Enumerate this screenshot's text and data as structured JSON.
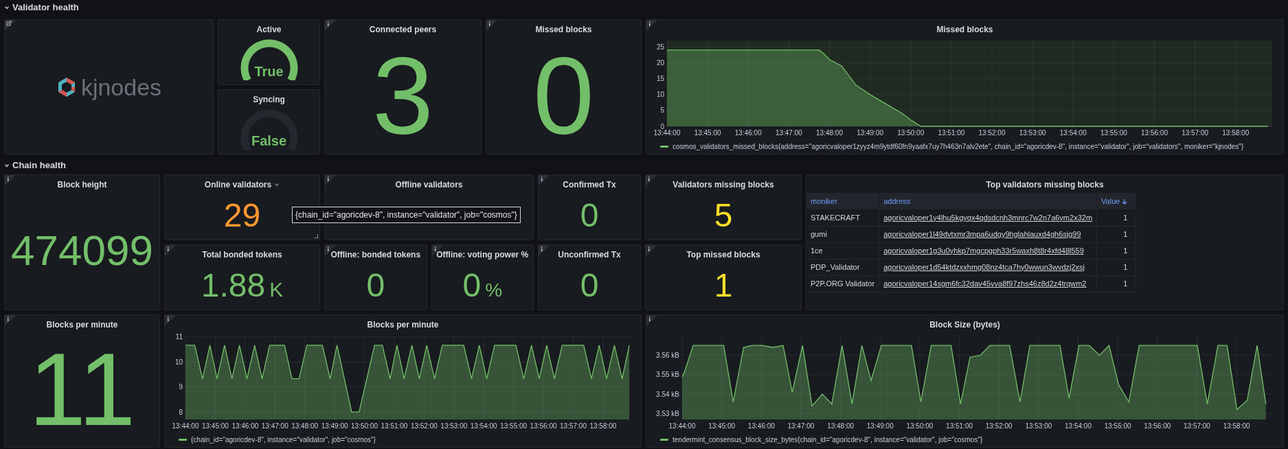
{
  "validator_health": {
    "title": "Validator health",
    "expanded": true,
    "logo": {
      "text": "kjnodes",
      "link": true
    },
    "gauges": [
      {
        "title": "Active",
        "value": "True",
        "on": true
      },
      {
        "title": "Syncing",
        "value": "False",
        "on": false
      }
    ],
    "stats": [
      {
        "title": "Connected peers",
        "value": "3",
        "color": "#73bf69",
        "info": true
      },
      {
        "title": "Missed blocks",
        "value": "0",
        "color": "#73bf69",
        "info": true
      }
    ],
    "chart": {
      "title": "Missed blocks",
      "info": true,
      "chart_data": {
        "type": "area",
        "grid": true,
        "xlim": [
          824,
          838.9
        ],
        "ylim": [
          0,
          27
        ],
        "xticks": [
          {
            "value": 824,
            "label": "13:44:00"
          },
          {
            "value": 825,
            "label": "13:45:00"
          },
          {
            "value": 826,
            "label": "13:46:00"
          },
          {
            "value": 827,
            "label": "13:47:00"
          },
          {
            "value": 828,
            "label": "13:48:00"
          },
          {
            "value": 829,
            "label": "13:49:00"
          },
          {
            "value": 830,
            "label": "13:50:00"
          },
          {
            "value": 831,
            "label": "13:51:00"
          },
          {
            "value": 832,
            "label": "13:52:00"
          },
          {
            "value": 833,
            "label": "13:53:00"
          },
          {
            "value": 834,
            "label": "13:54:00"
          },
          {
            "value": 835,
            "label": "13:55:00"
          },
          {
            "value": 836,
            "label": "13:56:00"
          },
          {
            "value": 837,
            "label": "13:57:00"
          },
          {
            "value": 838,
            "label": "13:58:00"
          }
        ],
        "yticks": [
          0,
          5,
          10,
          15,
          20,
          25
        ],
        "x": [
          824,
          827.75,
          827.85,
          828,
          828.3,
          828.65,
          829,
          829.4,
          829.8,
          830,
          830.25,
          838.8
        ],
        "series": [
          {
            "name": "cosmos_validators_missed_blocks{address=\"agoricvaloper1zyyz4m9ytdf60fn9yaafx7uy7h463n7alv2ete\", chain_id=\"agoricdev-8\", instance=\"validator\", job=\"validators\", moniker=\"kjnodes\"}",
            "color": "#73bf69",
            "values": [
              24,
              24,
              23,
              21,
              19,
              13,
              10,
              7,
              4,
              2,
              0,
              0
            ]
          }
        ]
      }
    }
  },
  "chain_health": {
    "title": "Chain health",
    "expanded": true,
    "stats": [
      {
        "title": "Block height",
        "value": "474099",
        "color": "#73bf69",
        "info": true
      },
      {
        "title": "Online validators",
        "value": "29",
        "color": "#ff9830",
        "hovered": true
      },
      {
        "title": "Offline validators",
        "info": true
      },
      {
        "title": "Confirmed Tx",
        "value": "0",
        "color": "#73bf69",
        "info": true
      },
      {
        "title": "Validators missing blocks",
        "value": "5",
        "color": "#fade2a",
        "info": true
      },
      {
        "title": "Total bonded tokens",
        "value": "1.88",
        "unit": "K",
        "color": "#73bf69",
        "info": true
      },
      {
        "title": "Offline: bonded tokens",
        "value": "0",
        "color": "#73bf69",
        "info": true
      },
      {
        "title": "Offline: voting power %",
        "value": "0",
        "unit": "%",
        "color": "#73bf69",
        "info": true
      },
      {
        "title": "Unconfirmed Tx",
        "value": "0",
        "color": "#73bf69",
        "info": true
      },
      {
        "title": "Top missed blocks",
        "value": "1",
        "color": "#fade2a",
        "info": true
      }
    ],
    "tooltip": {
      "text": "{chain_id=\"agoricdev-8\", instance=\"validator\", job=\"cosmos\"}"
    },
    "table": {
      "title": "Top validators missing blocks",
      "columns": [
        {
          "label": "moniker"
        },
        {
          "label": "address"
        },
        {
          "label": "Value",
          "sort_descending": true
        }
      ],
      "rows": [
        [
          "STAKECRAFT",
          "agoricvaloper1y4lhu5kgyqx4qdsdcnh3mnrc7w2n7a6ym2x32m",
          "1"
        ],
        [
          "gumi",
          "agoricvaloper1l49dvtxmr3mpa6udgy9hglahlauxd4gh6sjg99",
          "1"
        ],
        [
          "1ce",
          "agoricvaloper1g3u0yhkp7mgcpgph33r5waxh8t8r4xfd48l559",
          "1"
        ],
        [
          "PDP_Validator",
          "agoricvaloper1d54ktdzxxhmg08nz4tca7hy0wwun3wvdzj2xsj",
          "1"
        ],
        [
          "P2P.ORG Validator",
          "agoricvaloper14sgm6fc32dav45vva8f97zhs46z8d2z4trqwm2",
          "1"
        ]
      ]
    },
    "blocks_stat": {
      "title": "Blocks per minute",
      "value": "11",
      "color": "#73bf69",
      "info": true
    },
    "charts": [
      {
        "title": "Blocks per minute",
        "info": true,
        "chart_data": {
          "type": "area",
          "grid": true,
          "xlim": [
            824,
            838.9
          ],
          "ylim": [
            7.7,
            11.05
          ],
          "xticks": [
            {
              "value": 824,
              "label": "13:44:00"
            },
            {
              "value": 825,
              "label": "13:45:00"
            },
            {
              "value": 826,
              "label": "13:46:00"
            },
            {
              "value": 827,
              "label": "13:47:00"
            },
            {
              "value": 828,
              "label": "13:48:00"
            },
            {
              "value": 829,
              "label": "13:49:00"
            },
            {
              "value": 830,
              "label": "13:50:00"
            },
            {
              "value": 831,
              "label": "13:51:00"
            },
            {
              "value": 832,
              "label": "13:52:00"
            },
            {
              "value": 833,
              "label": "13:53:00"
            },
            {
              "value": 834,
              "label": "13:54:00"
            },
            {
              "value": 835,
              "label": "13:55:00"
            },
            {
              "value": 836,
              "label": "13:56:00"
            },
            {
              "value": 837,
              "label": "13:57:00"
            },
            {
              "value": 838,
              "label": "13:58:00"
            }
          ],
          "yticks": [
            8,
            9,
            10,
            11
          ],
          "x": [
            824,
            824.31,
            824.57,
            824.82,
            825.06,
            825.31,
            825.56,
            825.81,
            826.06,
            826.32,
            826.57,
            826.82,
            827.32,
            827.57,
            827.81,
            828.07,
            828.59,
            828.85,
            829.08,
            829.57,
            829.82,
            830.34,
            830.6,
            830.86,
            831.09,
            831.33,
            831.59,
            831.84,
            832.09,
            832.35,
            832.61,
            833.33,
            833.59,
            833.85,
            834.1,
            834.36,
            835.08,
            835.34,
            835.6,
            835.86,
            836.11,
            836.37,
            836.63,
            837.35,
            837.61,
            837.87,
            838.12,
            838.38,
            838.64,
            838.88
          ],
          "series": [
            {
              "name": "{chain_id=\"agoricdev-8\", instance=\"validator\", job=\"cosmos\"}",
              "color": "#73bf69",
              "values": [
                10.67,
                10.67,
                9.33,
                10.67,
                9.33,
                10.67,
                9.33,
                10.67,
                9.33,
                10.67,
                9.33,
                10.67,
                10.67,
                9.33,
                9.33,
                10.67,
                10.67,
                9.33,
                10.67,
                8,
                8,
                10.67,
                10.67,
                9.33,
                10.67,
                9.33,
                10.67,
                9.33,
                10.67,
                9.33,
                10.67,
                10.67,
                9.33,
                10.67,
                9.33,
                10.67,
                10.67,
                9.33,
                10.67,
                9.33,
                10.67,
                9.33,
                10.67,
                10.67,
                9.33,
                10.67,
                9.33,
                10.67,
                9.33,
                10.67
              ]
            }
          ]
        }
      },
      {
        "title": "Block Size (bytes)",
        "info": true,
        "chart_data": {
          "type": "area",
          "grid": true,
          "xlim": [
            824,
            838.9
          ],
          "ylim": [
            3.527,
            3.57
          ],
          "xticks": [
            {
              "value": 824,
              "label": "13:44:00"
            },
            {
              "value": 825,
              "label": "13:45:00"
            },
            {
              "value": 826,
              "label": "13:46:00"
            },
            {
              "value": 827,
              "label": "13:47:00"
            },
            {
              "value": 828,
              "label": "13:48:00"
            },
            {
              "value": 829,
              "label": "13:49:00"
            },
            {
              "value": 830,
              "label": "13:50:00"
            },
            {
              "value": 831,
              "label": "13:51:00"
            },
            {
              "value": 832,
              "label": "13:52:00"
            },
            {
              "value": 833,
              "label": "13:53:00"
            },
            {
              "value": 834,
              "label": "13:54:00"
            },
            {
              "value": 835,
              "label": "13:55:00"
            },
            {
              "value": 836,
              "label": "13:56:00"
            },
            {
              "value": 837,
              "label": "13:57:00"
            },
            {
              "value": 838,
              "label": "13:58:00"
            }
          ],
          "yticks": [
            {
              "value": 3.53,
              "label": "3.53 kB"
            },
            {
              "value": 3.54,
              "label": "3.54 kB"
            },
            {
              "value": 3.55,
              "label": "3.55 kB"
            },
            {
              "value": 3.56,
              "label": "3.56 kB"
            }
          ],
          "x": [
            824,
            824.05,
            824.28,
            825.05,
            825.29,
            825.55,
            825.77,
            826.03,
            826.29,
            826.55,
            826.78,
            827.04,
            827.28,
            827.54,
            827.78,
            828.04,
            828.29,
            828.54,
            828.77,
            829.03,
            829.79,
            830.03,
            830.29,
            830.79,
            831.03,
            831.27,
            831.53,
            831.77,
            832.27,
            832.53,
            832.78,
            833.54,
            833.77,
            834.02,
            834.28,
            834.54,
            834.78,
            835.02,
            835.28,
            835.54,
            837.01,
            837.26,
            837.53,
            837.76,
            838.01,
            838.27,
            838.52,
            838.74
          ],
          "series": [
            {
              "name": "tendermint_consensus_block_size_bytes{chain_id=\"agoricdev-8\", instance=\"validator\", job=\"cosmos\"}",
              "color": "#73bf69",
              "values": [
                3.549,
                3.551,
                3.565,
                3.565,
                3.536,
                3.564,
                3.565,
                3.565,
                3.564,
                3.565,
                3.541,
                3.565,
                3.534,
                3.54,
                3.535,
                3.565,
                3.535,
                3.565,
                3.547,
                3.565,
                3.565,
                3.536,
                3.565,
                3.565,
                3.535,
                3.559,
                3.56,
                3.565,
                3.565,
                3.536,
                3.565,
                3.565,
                3.538,
                3.565,
                3.565,
                3.56,
                3.565,
                3.545,
                3.536,
                3.565,
                3.565,
                3.535,
                3.565,
                3.565,
                3.532,
                3.537,
                3.565,
                3.535
              ]
            }
          ]
        }
      }
    ]
  }
}
